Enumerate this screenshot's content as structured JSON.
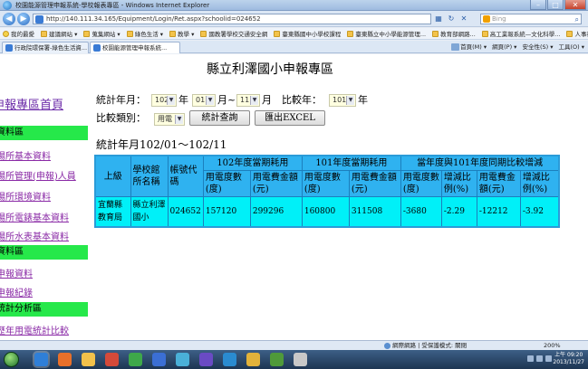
{
  "window": {
    "title": "校園能源管理申報系統-學校報表專區 - Windows Internet Explorer",
    "controls": [
      "–",
      "□",
      "✕"
    ]
  },
  "address": {
    "url": "http://140.111.34.165/Equipment/Login/Ret.aspx?schoolid=024652",
    "search_placeholder": "Bing"
  },
  "favorites": [
    {
      "label": "我的最愛"
    },
    {
      "label": "建議網站 ▾"
    },
    {
      "label": "蒐集網站 ▾"
    },
    {
      "label": "綠色生活 ▾"
    },
    {
      "label": "教學 ▾"
    },
    {
      "label": "國教署學校交通安全網"
    },
    {
      "label": "臺東縣國中小學校課程"
    },
    {
      "label": "臺東縣立中小學能源管理..."
    },
    {
      "label": "教育部網路..."
    },
    {
      "label": "高工業報系統—文化科學..."
    },
    {
      "label": "人事行政總處公務人員個..."
    }
  ],
  "tabs": [
    {
      "label": "行政院環保署-綠色生活資..."
    },
    {
      "label": "校園能源管理申報系統..."
    }
  ],
  "command_bar": [
    "首頁(M) ▾",
    "網頁(P) ▾",
    "安全性(S) ▾",
    "工具(O) ▾"
  ],
  "page": {
    "title": "縣立利澤國小申報專區"
  },
  "sidebar": {
    "home": "申報專區首頁",
    "groups": [
      {
        "header": "資料區",
        "links": [
          "場所基本資料",
          "場所管理(申報)人員",
          "場所環境資料",
          "場所電錶基本資料",
          "場所水表基本資料"
        ]
      },
      {
        "header": "資料區",
        "links": [
          "申報資料",
          "申報紀錄"
        ]
      },
      {
        "header": "統計分析區",
        "links": [
          "歷年用電統計比較"
        ]
      }
    ]
  },
  "form": {
    "stat_month_label": "統計年月：",
    "year_value": "102",
    "year_unit": "年",
    "from_month_value": "01",
    "month_unit": "月~",
    "to_month_value": "11",
    "month_unit2": "月",
    "compare_year_label": "比較年：",
    "compare_year_value": "101",
    "compare_year_unit": "年",
    "compare_type_label": "比較類別：",
    "compare_type_value": "用電",
    "query_button": "統計查詢",
    "export_button": "匯出EXCEL"
  },
  "section_title": "統計年月102/01～102/11",
  "table": {
    "headers": {
      "level": "上級",
      "school": "學校館所名稱",
      "code": "帳號代碼",
      "group_102": "102年度當期耗用",
      "group_101": "101年度當期耗用",
      "group_diff": "當年度與101年度同期比較增減",
      "kwh": "用電度數(度)",
      "fee": "用電費金額(元)",
      "kwh_diff": "用電度數(度)",
      "pct_kwh": "增減比例(%)",
      "fee_diff": "用電費金額(元)",
      "pct_fee": "增減比例(%)"
    },
    "rows": [
      {
        "level": "宜蘭縣教育局",
        "school": "縣立利澤國小",
        "code": "024652",
        "kwh_102": "157120",
        "fee_102": "299296",
        "kwh_101": "160800",
        "fee_101": "311508",
        "kwh_diff": "-3680",
        "pct_kwh": "-2.29",
        "fee_diff": "-12212",
        "pct_fee": "-3.92"
      }
    ]
  },
  "status": {
    "zone": "網際網路 | 受保護模式: 關閉",
    "zoom": "200%"
  },
  "clock": {
    "time": "上午 09:20",
    "date": "2013/11/27"
  }
}
